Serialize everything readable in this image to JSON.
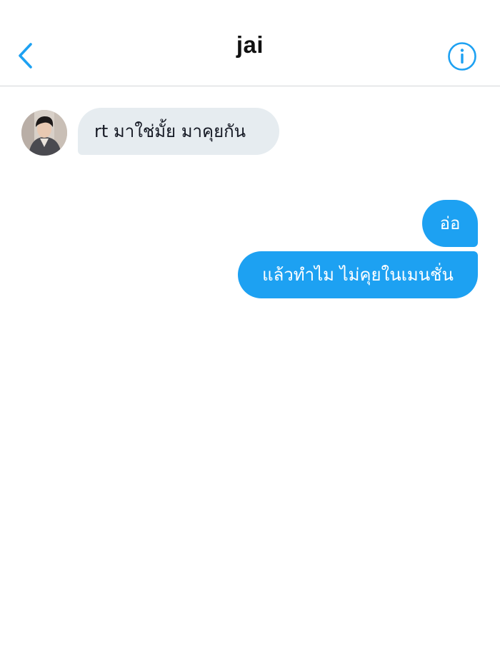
{
  "header": {
    "title": "jai",
    "back_icon": "chevron-left-icon",
    "info_icon": "info-icon"
  },
  "colors": {
    "accent": "#1da1f2",
    "incoming_bubble": "#e6ecf0",
    "divider": "#d3d6d8"
  },
  "conversation": {
    "incoming": [
      {
        "text": "rt มาใช่มั้ย มาคุยกัน"
      }
    ],
    "outgoing": [
      {
        "text": "อ่อ"
      },
      {
        "text": "แล้วทำไม ไม่คุยในเมนชั่น"
      }
    ]
  }
}
